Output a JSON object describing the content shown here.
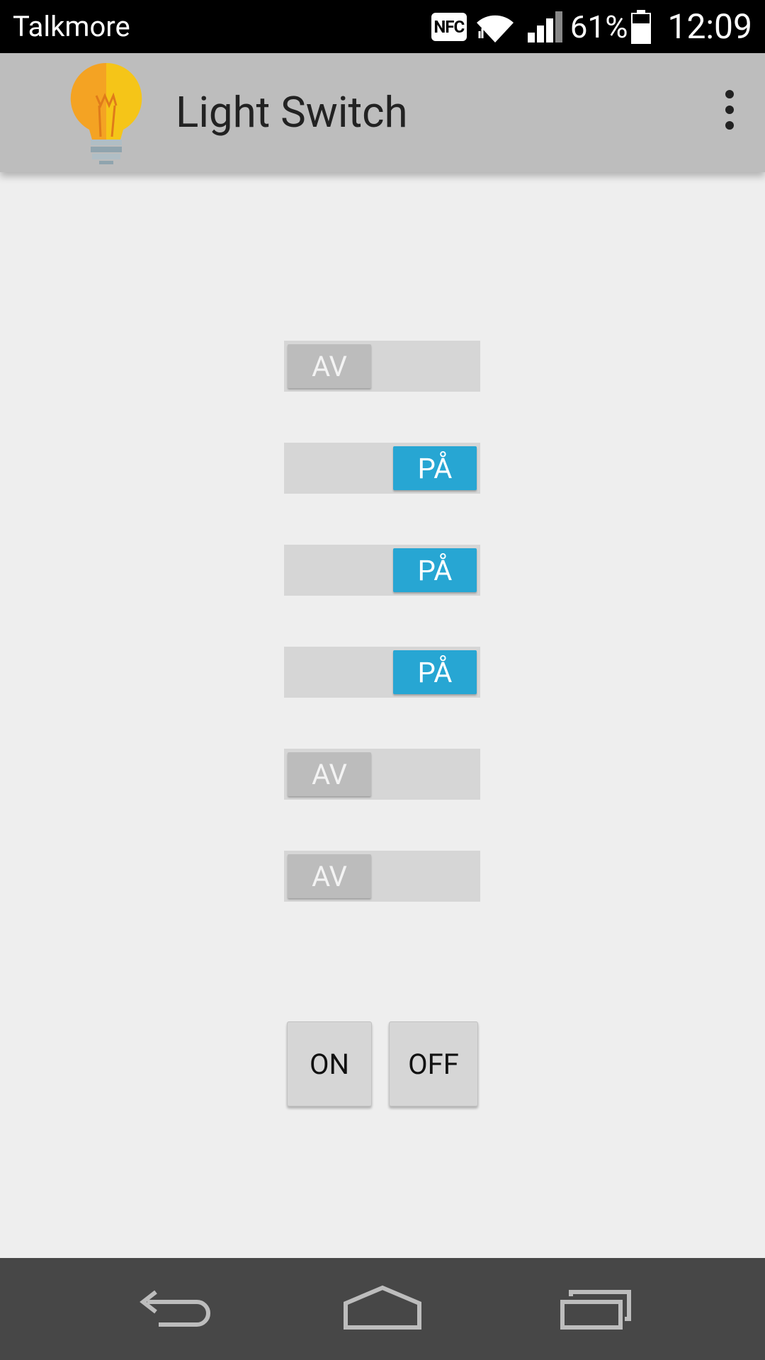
{
  "status_bar": {
    "carrier": "Talkmore",
    "nfc_label": "NFC",
    "battery_percent": "61%",
    "time": "12:09",
    "icons": [
      "nfc-icon",
      "wifi-icon",
      "signal-icon",
      "battery-icon"
    ]
  },
  "action_bar": {
    "title": "Light Switch",
    "app_icon": "lightbulb-icon",
    "menu_icon": "overflow-menu-icon"
  },
  "switches": [
    {
      "label": "AV",
      "state": "off"
    },
    {
      "label": "PÅ",
      "state": "on"
    },
    {
      "label": "PÅ",
      "state": "on"
    },
    {
      "label": "PÅ",
      "state": "on"
    },
    {
      "label": "AV",
      "state": "off"
    },
    {
      "label": "AV",
      "state": "off"
    }
  ],
  "buttons": {
    "on_label": "ON",
    "off_label": "OFF"
  },
  "nav_bar": {
    "icons": [
      "back-icon",
      "home-icon",
      "recents-icon"
    ]
  },
  "colors": {
    "accent": "#27a6d3",
    "action_bar": "#bdbdbd",
    "background": "#eeeeee",
    "nav_bar": "#474747"
  }
}
